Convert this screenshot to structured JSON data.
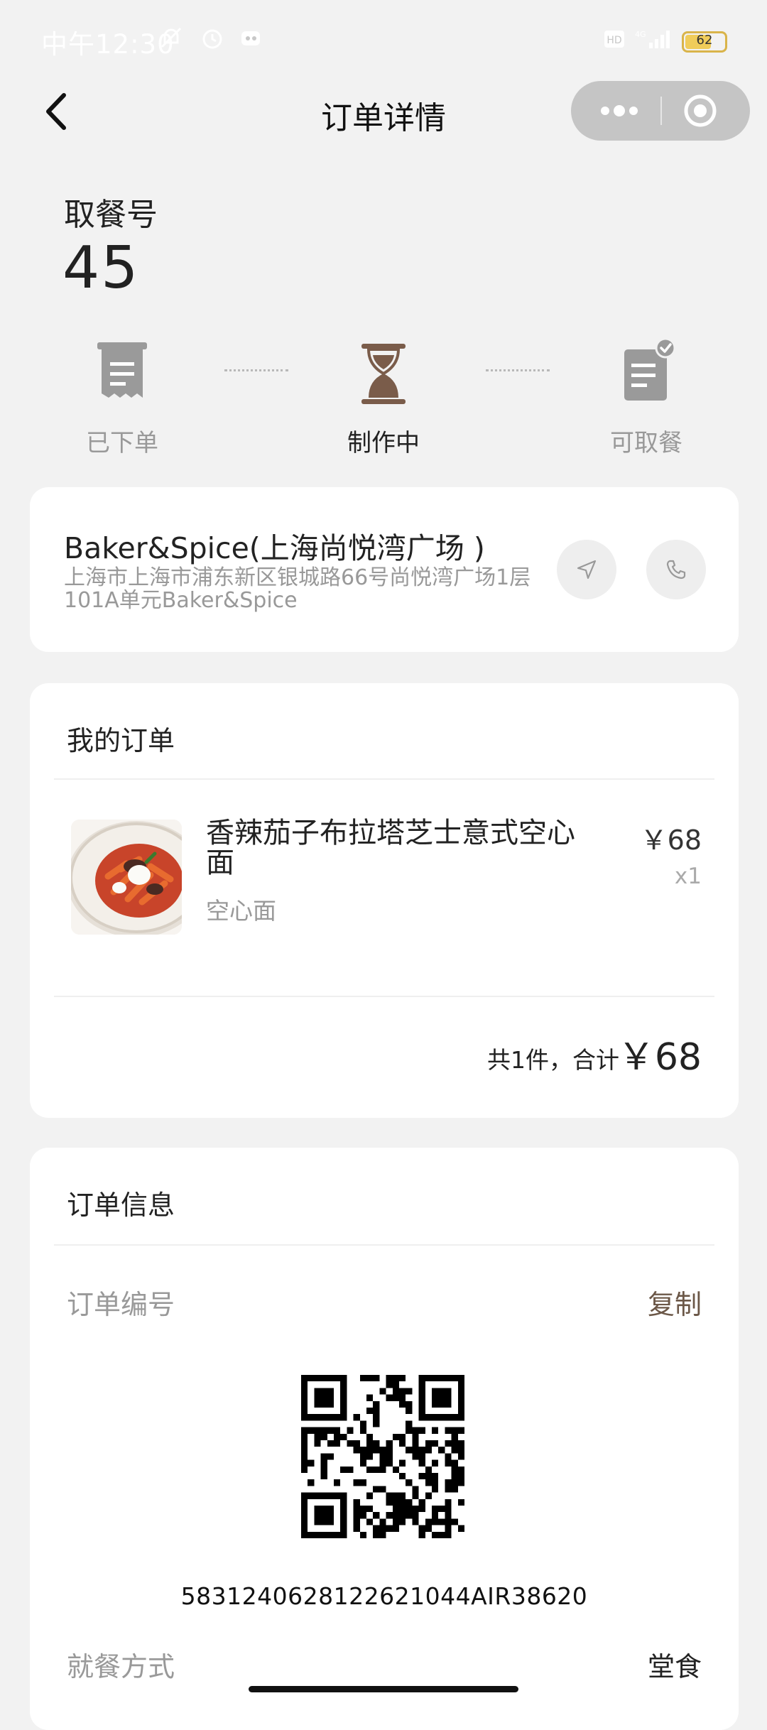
{
  "status_bar": {
    "time": "中午12:30",
    "battery": "62"
  },
  "nav": {
    "title": "订单详情"
  },
  "pickup": {
    "label": "取餐号",
    "number": "45"
  },
  "progress": {
    "steps": [
      {
        "label": "已下单",
        "state": "done"
      },
      {
        "label": "制作中",
        "state": "current"
      },
      {
        "label": "可取餐",
        "state": "pending"
      }
    ]
  },
  "store": {
    "name": "Baker&Spice(上海尚悦湾广场 )",
    "address": "上海市上海市浦东新区银城路66号尚悦湾广场1层101A单元Baker&Spice"
  },
  "order": {
    "title": "我的订单",
    "item": {
      "name": "香辣茄子布拉塔芝士意式空心面",
      "category": "空心面",
      "price": "￥68",
      "qty": "x1"
    },
    "total_label": "共1件，合计",
    "total": "￥68"
  },
  "info": {
    "title": "订单信息",
    "order_no_label": "订单编号",
    "copy_label": "复制",
    "order_no": "5831240628122621044AIR38620",
    "dining_label": "就餐方式",
    "dining_value": "堂食"
  },
  "colors": {
    "brown": "#7a5c4a",
    "gray": "#9a9a9a",
    "copy": "#6b5747"
  }
}
